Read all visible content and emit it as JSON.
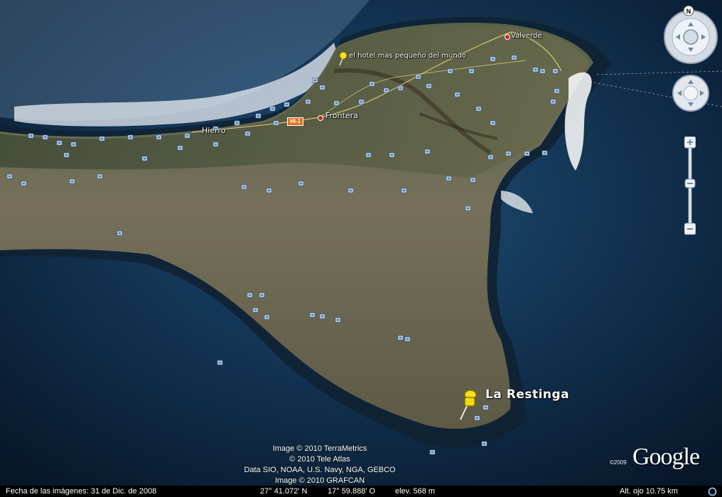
{
  "map": {
    "places": {
      "hotel": "el hotel mas pequeño del mundo",
      "valverde": "Valverde",
      "frontera": "Frontera",
      "hierro": "Hierro",
      "la_restinga": "La Restinga",
      "road_shield": "HI-1"
    },
    "credits": [
      "Image © 2010 TerraMetrics",
      "© 2010 Tele Atlas",
      "Data SIO, NOAA, U.S. Navy, NGA, GEBCO",
      "Image © 2010 GRAFCAN"
    ],
    "logo": "Google",
    "logo_year": "©2009",
    "icons": [
      "placemark-pushpin-icon",
      "photo-icon",
      "compass-icon",
      "look-joystick-icon",
      "move-joystick-icon",
      "zoom-in-icon",
      "zoom-out-icon"
    ]
  },
  "navigation": {
    "compass_north": "N"
  },
  "status": {
    "imagery_date": "Fecha de las imágenes: 31 de Dic. de 2008",
    "latitude": "27° 41.072' N",
    "longitude": "17° 59.888' O",
    "elevation": "elev.  568 m",
    "eye_alt": "Alt. ojo   10.75 km"
  },
  "colors": {
    "ocean": "#0d2743",
    "land": "#6b6a4a",
    "pushpin": "#f5e21a"
  }
}
